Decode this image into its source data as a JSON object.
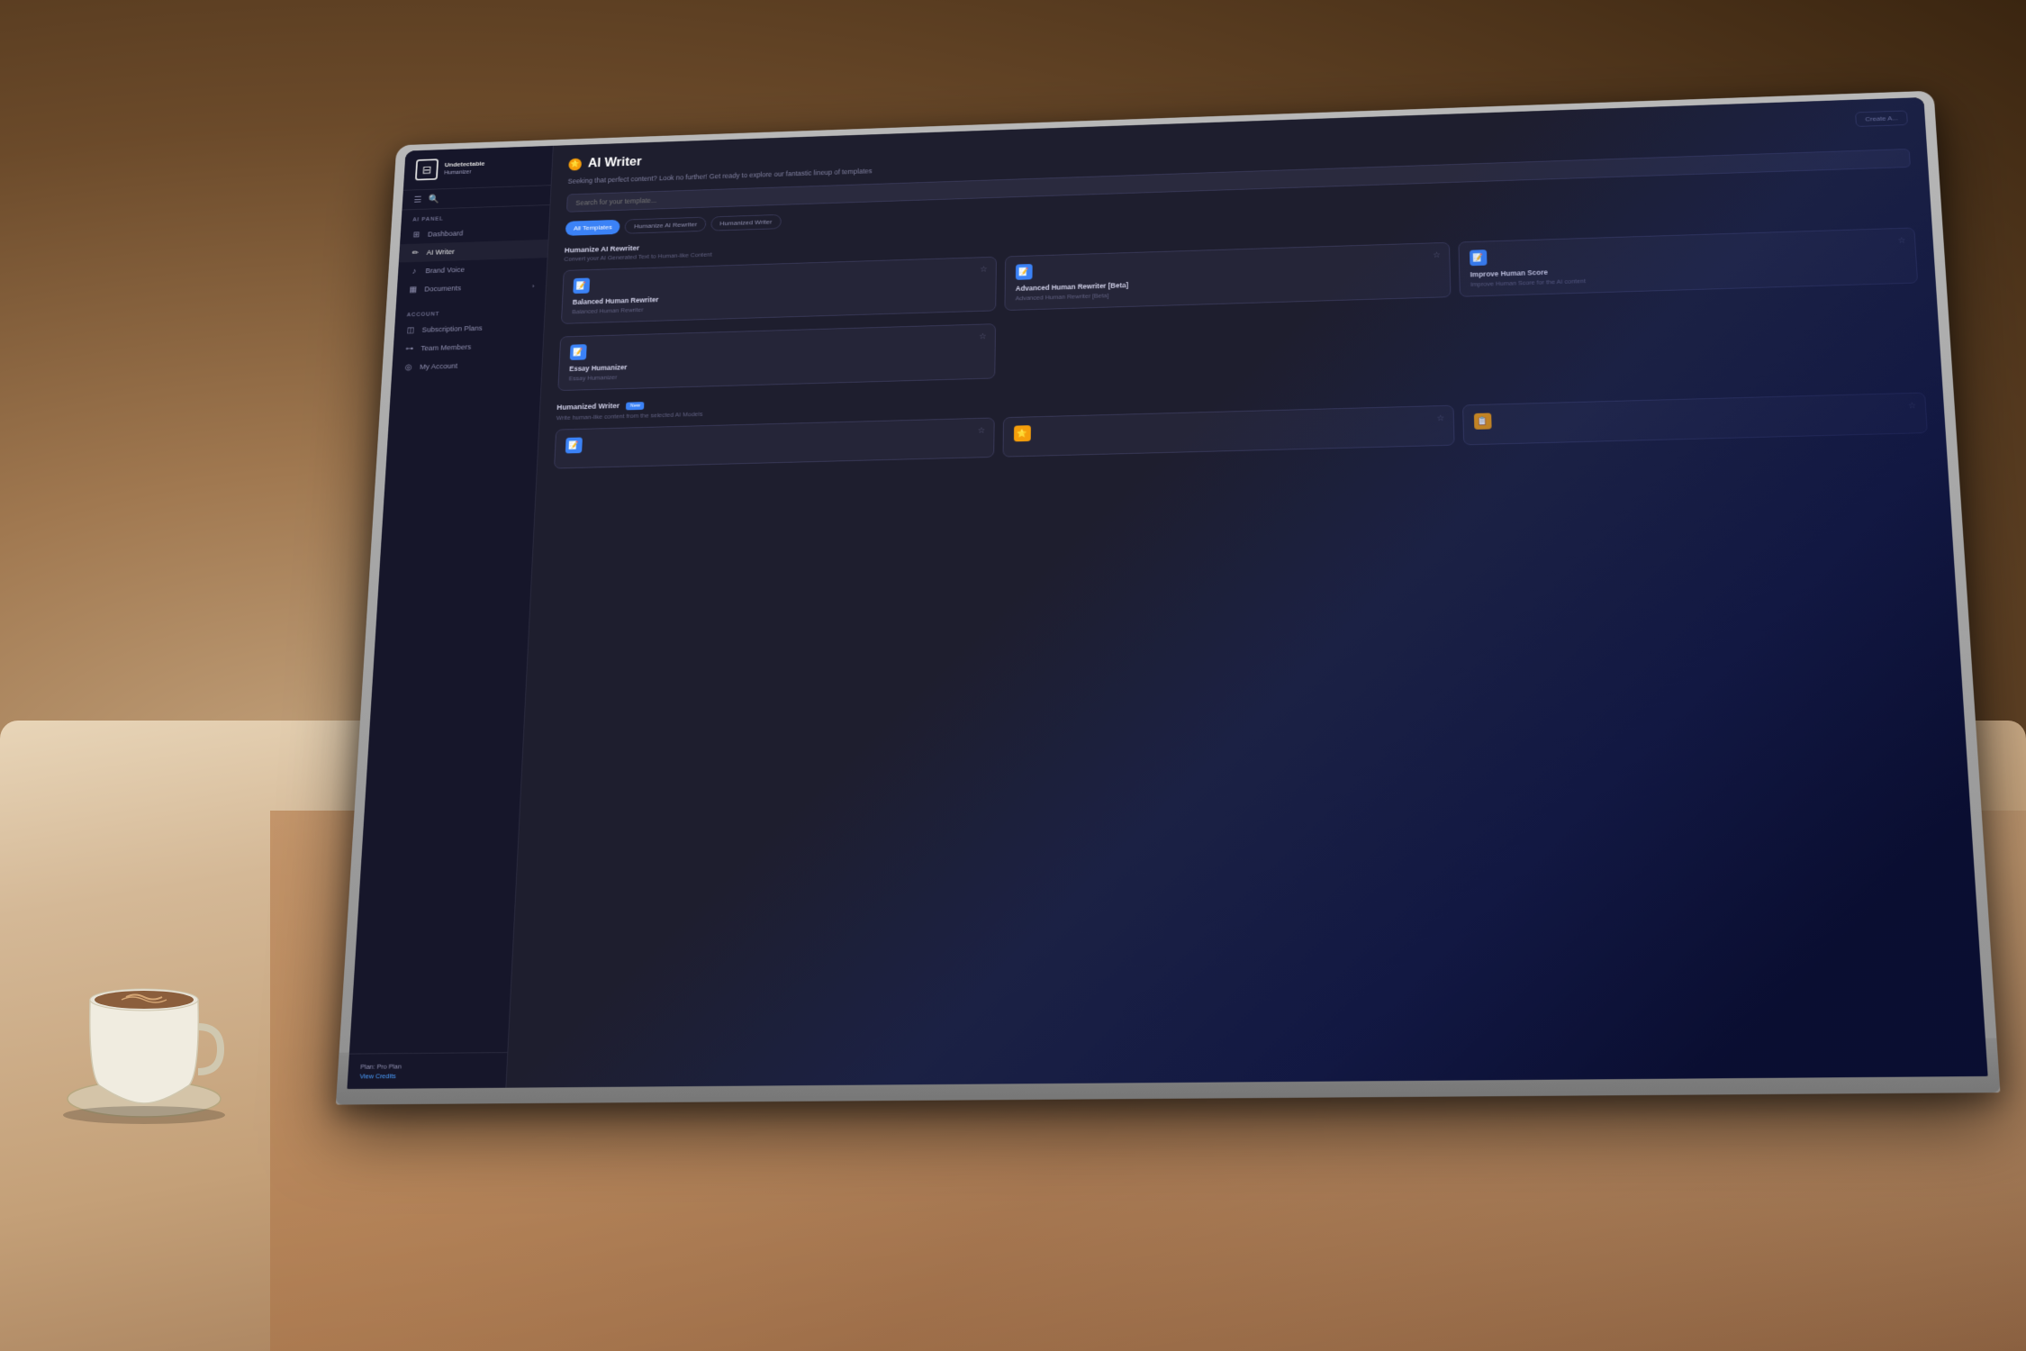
{
  "background": {
    "colors": {
      "table": "#c4a078",
      "bg_dark": "#3a2510",
      "screen_bg": "#1e1e2e"
    }
  },
  "app": {
    "logo": {
      "icon": "🤖",
      "line1": "Undetectable",
      "line2": "Humanizer"
    },
    "topbar": {
      "menu_icon": "☰",
      "search_icon": "🔍"
    },
    "sidebar": {
      "ai_panel_label": "AI PANEL",
      "account_label": "ACCOUNT",
      "items": [
        {
          "id": "dashboard",
          "icon": "⊞",
          "label": "Dashboard"
        },
        {
          "id": "ai-writer",
          "icon": "✏️",
          "label": "AI Writer"
        },
        {
          "id": "brand-voice",
          "icon": "🎵",
          "label": "Brand Voice"
        },
        {
          "id": "documents",
          "icon": "📄",
          "label": "Documents",
          "has_arrow": true
        }
      ],
      "account_items": [
        {
          "id": "subscription",
          "icon": "💳",
          "label": "Subscription Plans"
        },
        {
          "id": "team",
          "icon": "👥",
          "label": "Team Members"
        },
        {
          "id": "my-account",
          "icon": "👤",
          "label": "My Account"
        }
      ],
      "plan": {
        "label": "Plan: Pro Plan",
        "credits_label": "View Credits"
      }
    },
    "main": {
      "page_title": "AI Writer",
      "page_title_icon": "⭐",
      "page_subtitle": "Seeking that perfect content? Look no further! Get ready to explore our fantastic lineup of templates",
      "create_btn": "Create A...",
      "search_placeholder": "Search for your template...",
      "filter_tabs": [
        {
          "id": "all",
          "label": "All Templates",
          "active": true
        },
        {
          "id": "humanize",
          "label": "Humanize AI Rewriter",
          "active": false
        },
        {
          "id": "humanized",
          "label": "Humanized Writer",
          "active": false
        }
      ],
      "sections": [
        {
          "id": "humanize-ai",
          "title": "Humanize AI Rewriter",
          "subtitle": "Convert your AI Generated Text to Human-like Content",
          "cards": [
            {
              "id": "balanced",
              "icon": "📝",
              "title": "Balanced Human Rewriter",
              "description": "Balanced Human Rewriter",
              "starred": false,
              "badge": null
            },
            {
              "id": "advanced",
              "icon": "📝",
              "title": "Advanced Human Rewriter [Beta]",
              "description": "Advanced Human Rewriter [Beta]",
              "starred": false,
              "badge": null
            },
            {
              "id": "improve",
              "icon": "📝",
              "title": "Improve Human Score",
              "description": "Improve Human Score for the AI content",
              "starred": false,
              "badge": null
            }
          ]
        },
        {
          "id": "essay",
          "cards_extra": [
            {
              "id": "essay-humanizer",
              "icon": "📝",
              "title": "Essay Humanizer",
              "description": "Essay Humanizer",
              "starred": false,
              "badge": null
            }
          ]
        },
        {
          "id": "humanized-writer",
          "title": "Humanized Writer",
          "subtitle": "Write human-like content from the selected AI Models",
          "badge": "New",
          "cards": [
            {
              "id": "hw-card1",
              "icon": "📝",
              "title": "",
              "description": "",
              "starred": false
            },
            {
              "id": "hw-card2",
              "icon": "⭐",
              "title": "",
              "description": "",
              "starred": false
            },
            {
              "id": "hw-card3",
              "icon": "📋",
              "title": "",
              "description": "",
              "starred": false
            }
          ]
        }
      ]
    }
  }
}
